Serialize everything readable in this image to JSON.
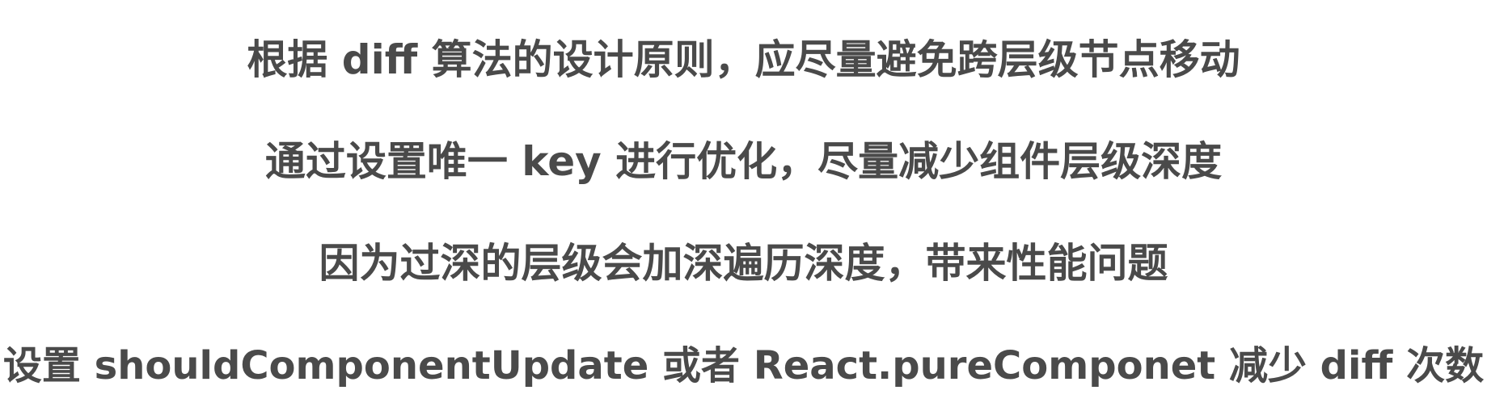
{
  "lines": [
    "根据 diff 算法的设计原则，应尽量避免跨层级节点移动",
    "通过设置唯一 key 进行优化，尽量减少组件层级深度",
    "因为过深的层级会加深遍历深度，带来性能问题",
    "设置 shouldComponentUpdate 或者 React.pureComponet 减少 diff 次数"
  ],
  "colors": {
    "text": "#4a4a4a",
    "background": "#ffffff"
  }
}
